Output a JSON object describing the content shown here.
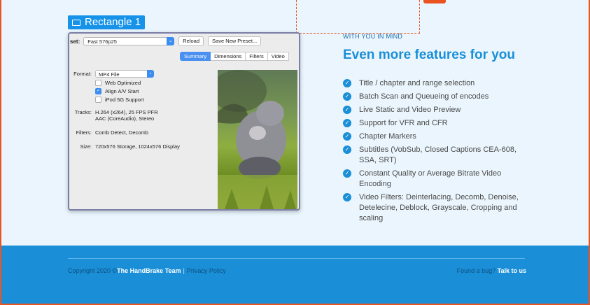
{
  "design_tool": {
    "selection_label": "Rectangle 1"
  },
  "screenshot": {
    "preset_label": "set:",
    "preset_value": "Fast 576p25",
    "reload_button": "Reload",
    "save_preset_button": "Save New Preset...",
    "tabs": [
      "Summary",
      "Dimensions",
      "Filters",
      "Video"
    ],
    "active_tab": "Summary",
    "format_label": "Format:",
    "format_value": "MP4 File",
    "checkboxes": [
      {
        "label": "Web Optimized",
        "checked": false
      },
      {
        "label": "Align A/V Start",
        "checked": true
      },
      {
        "label": "iPod 5G Support",
        "checked": false
      }
    ],
    "tracks_label": "Tracks:",
    "tracks_line1": "H.264 (x264), 25 FPS PFR",
    "tracks_line2": "AAC (CoreAudio), Stereo",
    "filters_label": "Filters:",
    "filters_value": "Comb Detect, Decomb",
    "size_label": "Size:",
    "size_value": "720x576 Storage, 1024x576 Display"
  },
  "features_section": {
    "eyebrow": "WITH YOU IN MIND",
    "heading": "Even more features for you",
    "items": [
      "Title / chapter and range selection",
      "Batch Scan and Queueing of encodes",
      "Live Static and Video Preview",
      "Support for VFR and CFR",
      "Chapter Markers",
      "Subtitles (VobSub, Closed Captions CEA-608, SSA, SRT)",
      "Constant Quality or Average Bitrate Video Encoding",
      "Video Filters: Deinterlacing, Decomb, Denoise, Detelecine, Deblock, Grayscale, Cropping and scaling"
    ]
  },
  "footer": {
    "copyright_prefix": "Copyright 2020 ©",
    "team_name": "The HandBrake Team",
    "separator": "|",
    "privacy_link": "Privacy Policy",
    "bug_text": "Found a bug?",
    "bug_link": "Talk to us"
  },
  "colors": {
    "accent_blue": "#1a8fd8",
    "page_bg": "#eaf5fd",
    "frame_orange": "#e95420"
  }
}
